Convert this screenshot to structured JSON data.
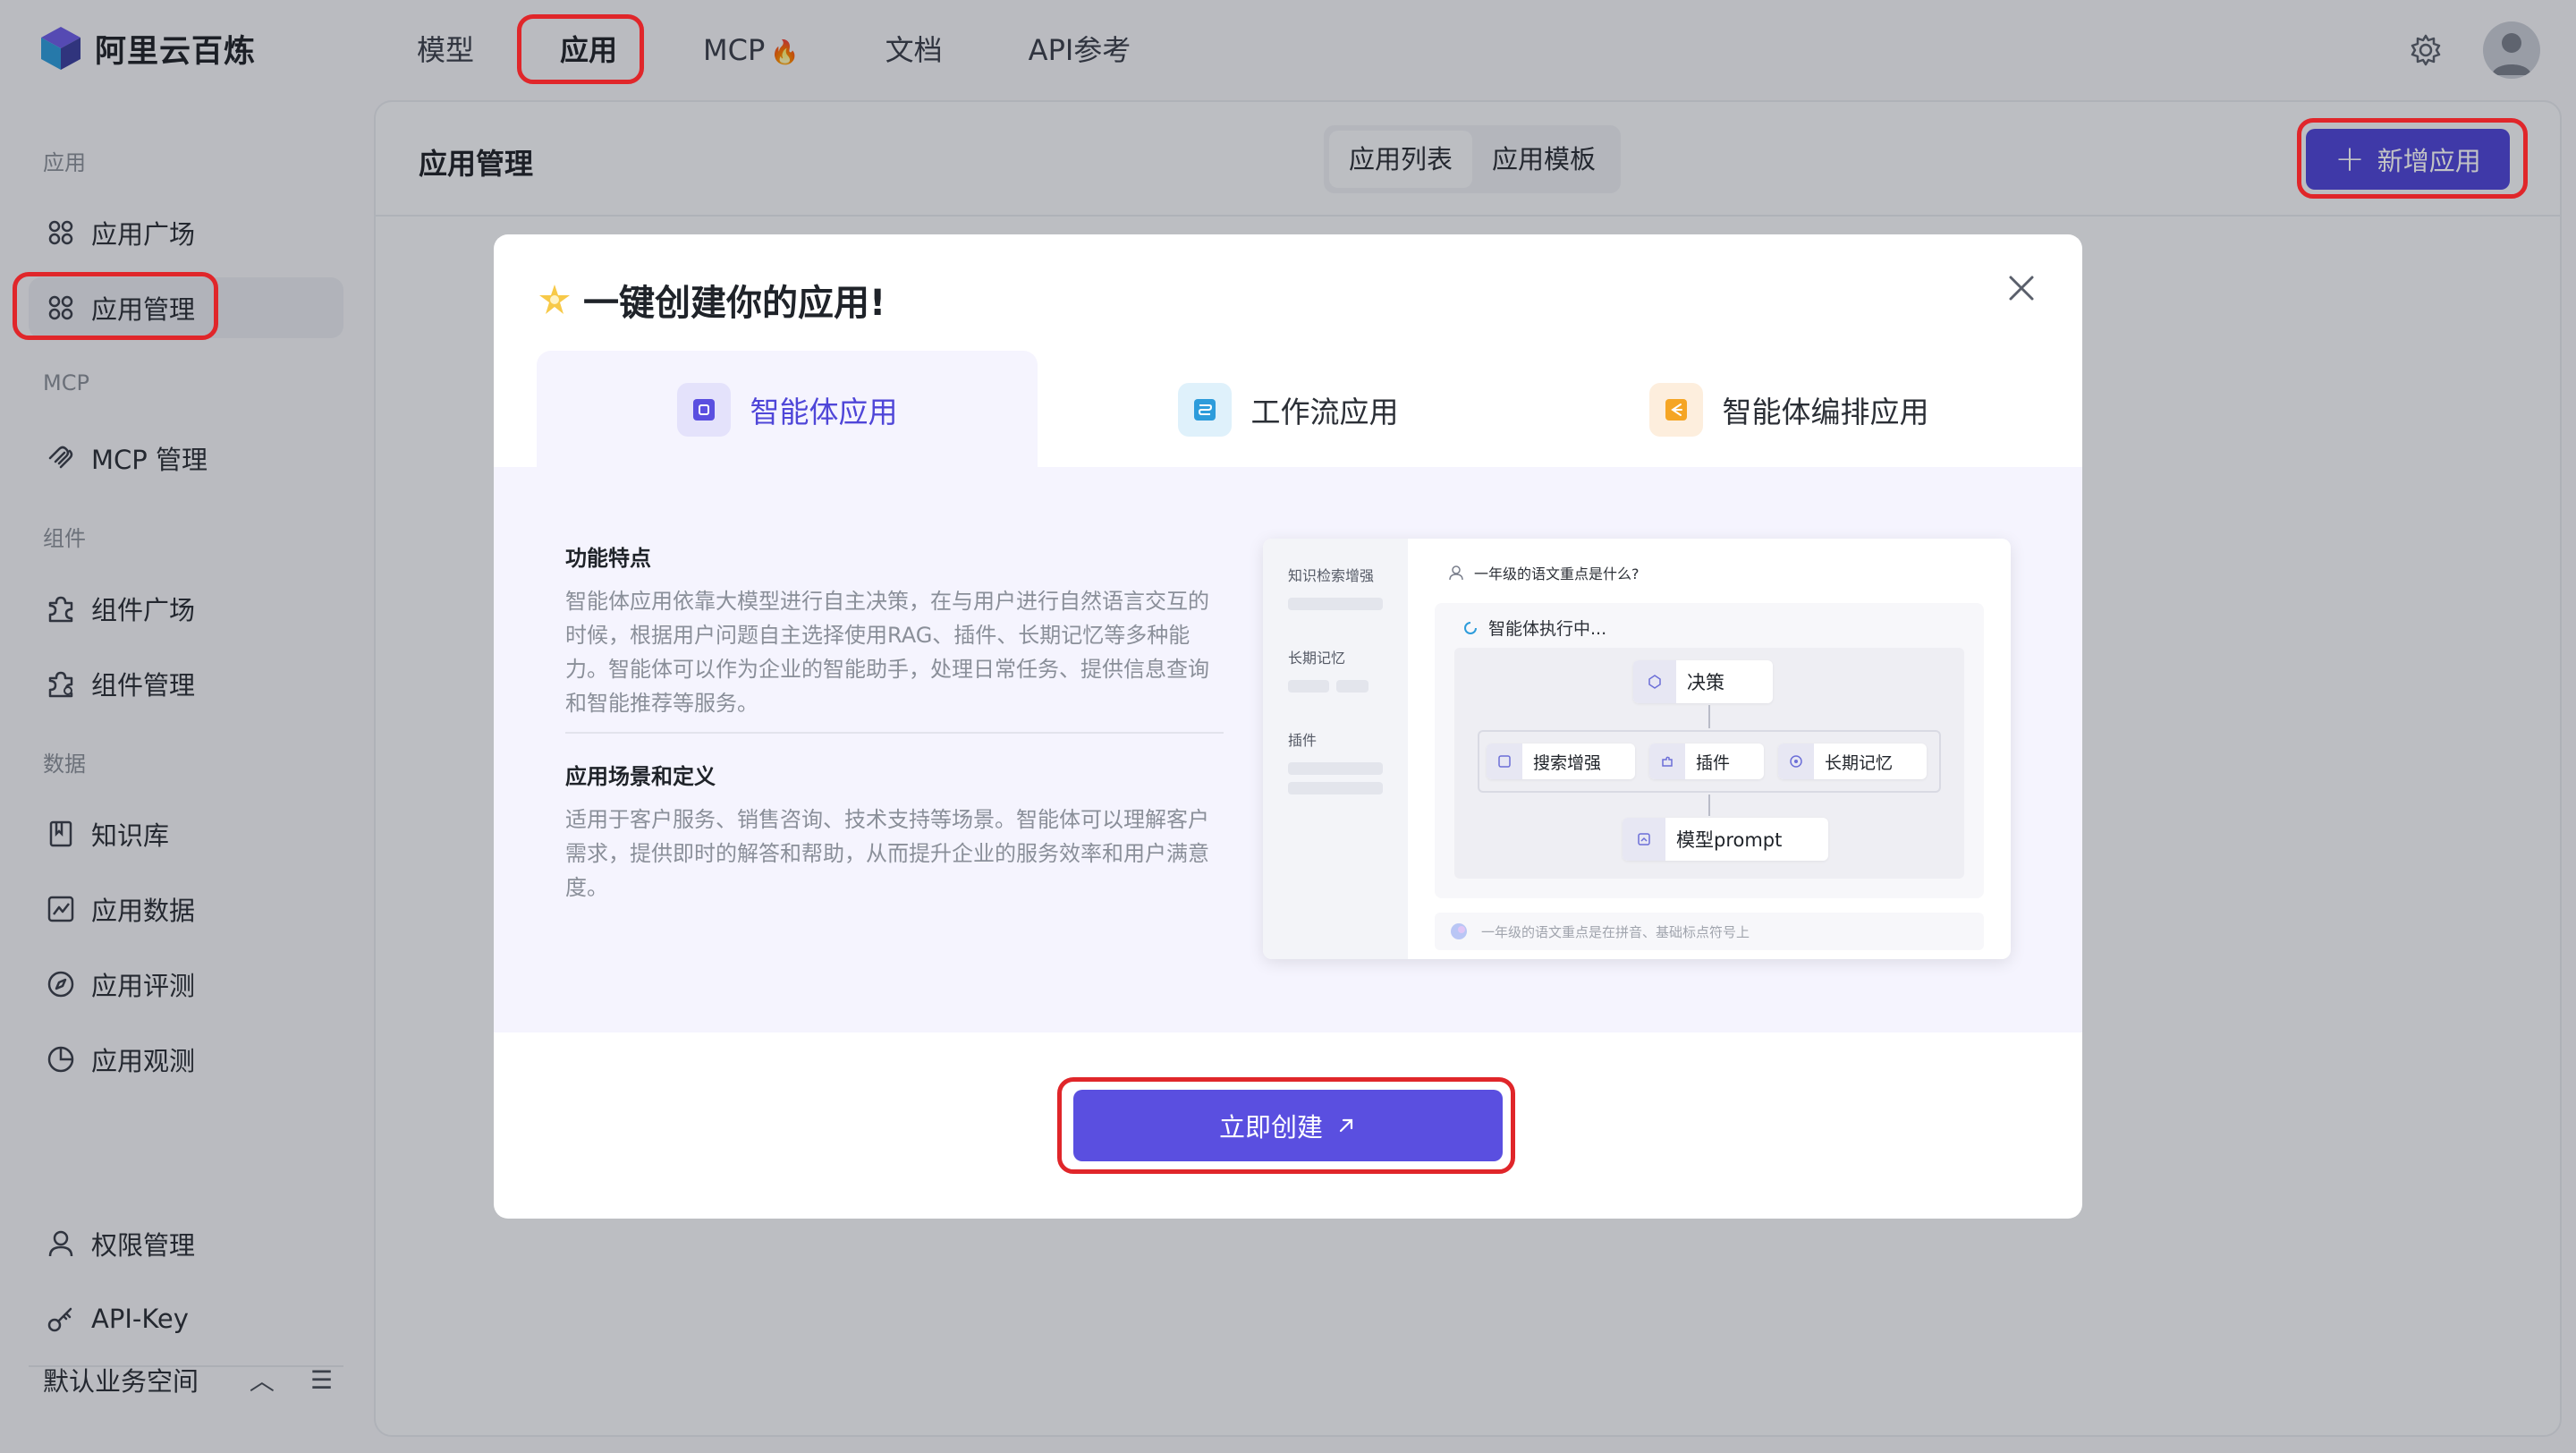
{
  "brand": {
    "name": "阿里云百炼"
  },
  "nav": [
    {
      "label": "模型"
    },
    {
      "label": "应用"
    },
    {
      "label": "MCP",
      "badge": "🔥"
    },
    {
      "label": "文档"
    },
    {
      "label": "API参考"
    }
  ],
  "sidebar": {
    "groups": {
      "app": "应用",
      "mcp": "MCP",
      "component": "组件",
      "data": "数据"
    },
    "items": [
      {
        "label": "应用广场",
        "icon": "apps-icon"
      },
      {
        "label": "应用管理",
        "icon": "apps-icon"
      },
      {
        "label": "MCP 管理",
        "icon": "mcp-icon"
      },
      {
        "label": "组件广场",
        "icon": "puzzle-icon"
      },
      {
        "label": "组件管理",
        "icon": "puzzle-settings-icon"
      },
      {
        "label": "知识库",
        "icon": "book-icon"
      },
      {
        "label": "应用数据",
        "icon": "line-chart-icon"
      },
      {
        "label": "应用评测",
        "icon": "compass-icon"
      },
      {
        "label": "应用观测",
        "icon": "pie-chart-icon"
      },
      {
        "label": "权限管理",
        "icon": "user-icon"
      },
      {
        "label": "API-Key",
        "icon": "key-icon"
      }
    ],
    "workspace": "默认业务空间"
  },
  "main": {
    "title": "应用管理",
    "segments": [
      "应用列表",
      "应用模板"
    ],
    "add_button": "新增应用"
  },
  "modal": {
    "title": "一键创建你的应用!",
    "tabs": [
      {
        "label": "智能体应用"
      },
      {
        "label": "工作流应用"
      },
      {
        "label": "智能体编排应用"
      }
    ],
    "features_title": "功能特点",
    "features_text": "智能体应用依靠大模型进行自主决策，在与用户进行自然语言交互的时候，根据用户问题自主选择使用RAG、插件、长期记忆等多种能力。智能体可以作为企业的智能助手，处理日常任务、提供信息查询和智能推荐等服务。",
    "scenarios_title": "应用场景和定义",
    "scenarios_text": "适用于客户服务、销售咨询、技术支持等场景。智能体可以理解客户需求，提供即时的解答和帮助，从而提升企业的服务效率和用户满意度。",
    "preview": {
      "left_labels": [
        "知识检索增强",
        "长期记忆",
        "插件"
      ],
      "question": "一年级的语文重点是什么?",
      "running": "智能体执行中...",
      "nodes": {
        "decision": "决策",
        "search": "搜索增强",
        "plugin": "插件",
        "memory": "长期记忆",
        "prompt": "模型prompt"
      },
      "answer": "一年级的语文重点是在拼音、基础标点符号上"
    },
    "create_button": "立即创建"
  },
  "colors": {
    "accent": "#4f46d8",
    "highlight": "#e0262a"
  }
}
